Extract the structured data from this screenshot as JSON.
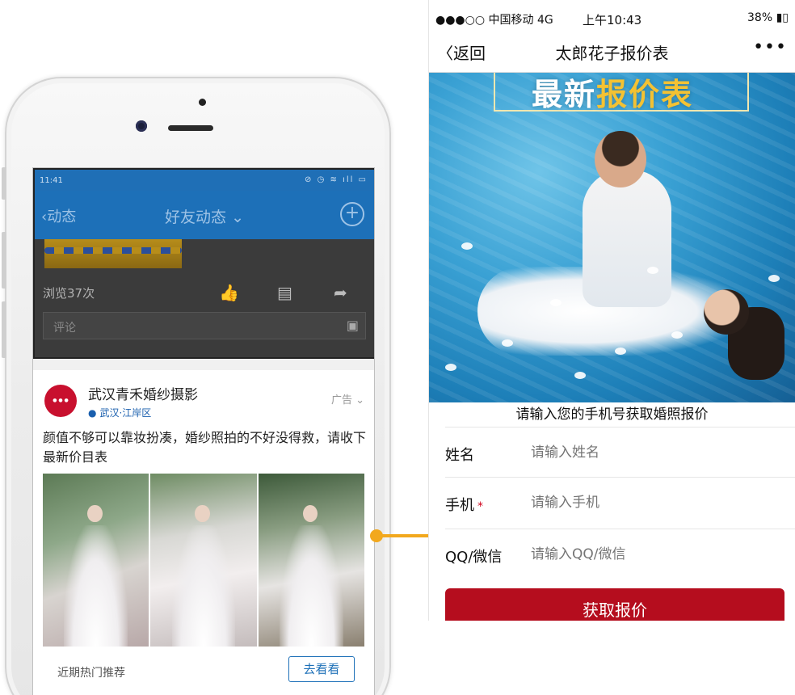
{
  "left_phone": {
    "status_time": "11:41",
    "nav": {
      "back_label": "动态",
      "title": "好友动态"
    },
    "post_prev": {
      "views": "浏览37次",
      "comment_placeholder": "评论"
    },
    "ad_card": {
      "shop_name": "武汉青禾婚纱摄影",
      "location": "武汉·江岸区",
      "ad_label": "广告",
      "text": "颜值不够可以靠妆扮凑，婚纱照拍的不好没得救，请收下最新价目表",
      "recommend": "近期热门推荐",
      "go_button": "去看看"
    }
  },
  "right_phone": {
    "status": {
      "carrier": "●●●○○ 中国移动  4G",
      "time": "上午10:43",
      "battery": "38%"
    },
    "nav": {
      "back_label": "返回",
      "title": "太郎花子报价表",
      "more": "•••"
    },
    "hero": {
      "title_white": "最新",
      "title_highlight": "报价表"
    },
    "form": {
      "heading": "请输入您的手机号获取婚照报价",
      "name_label": "姓名",
      "name_placeholder": "请输入姓名",
      "phone_label": "手机",
      "phone_required": "*",
      "phone_placeholder": "请输入手机",
      "qq_label": "QQ/微信",
      "qq_placeholder": "请输入QQ/微信",
      "submit": "获取报价"
    }
  },
  "colors": {
    "qq_blue": "#1d70b8",
    "arrow": "#f2a81d",
    "submit_red": "#b50d1e"
  }
}
